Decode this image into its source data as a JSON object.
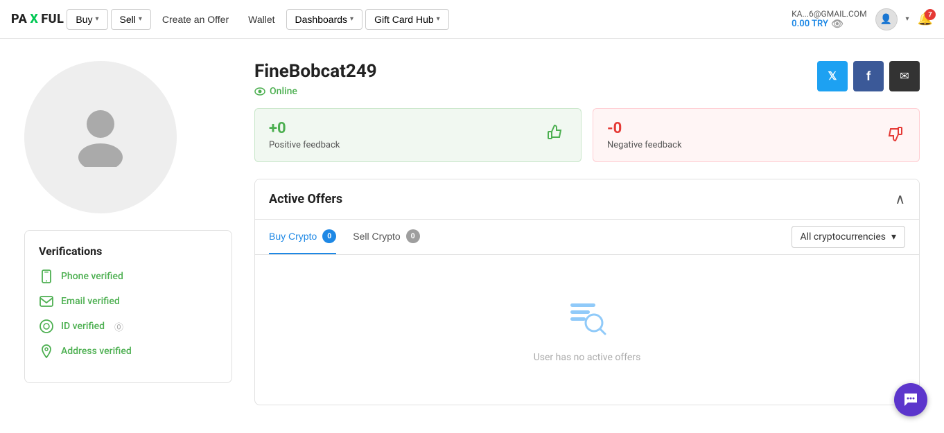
{
  "navbar": {
    "logo_text": "PA",
    "logo_x": "X",
    "logo_rest": "FUL",
    "buy_label": "Buy",
    "sell_label": "Sell",
    "create_offer_label": "Create an Offer",
    "wallet_label": "Wallet",
    "dashboards_label": "Dashboards",
    "gift_card_hub_label": "Gift Card Hub",
    "user_email": "KA...6@GMAIL.COM",
    "user_balance": "0.00 TRY",
    "notification_count": "7"
  },
  "profile": {
    "username": "FineBobcat249",
    "status": "Online",
    "positive_value": "+0",
    "positive_label": "Positive feedback",
    "negative_value": "-0",
    "negative_label": "Negative feedback"
  },
  "verifications": {
    "title": "Verifications",
    "items": [
      {
        "label": "Phone verified",
        "type": "phone"
      },
      {
        "label": "Email verified",
        "type": "email"
      },
      {
        "label": "ID verified",
        "type": "id",
        "has_help": true
      },
      {
        "label": "Address verified",
        "type": "address"
      }
    ]
  },
  "active_offers": {
    "title": "Active Offers",
    "tab_buy_label": "Buy Crypto",
    "tab_buy_count": "0",
    "tab_sell_label": "Sell Crypto",
    "tab_sell_count": "0",
    "crypto_select_label": "All cryptocurrencies",
    "empty_text": "User has no active offers"
  },
  "social": {
    "twitter_icon": "𝕏",
    "facebook_icon": "f",
    "email_icon": "✉"
  }
}
